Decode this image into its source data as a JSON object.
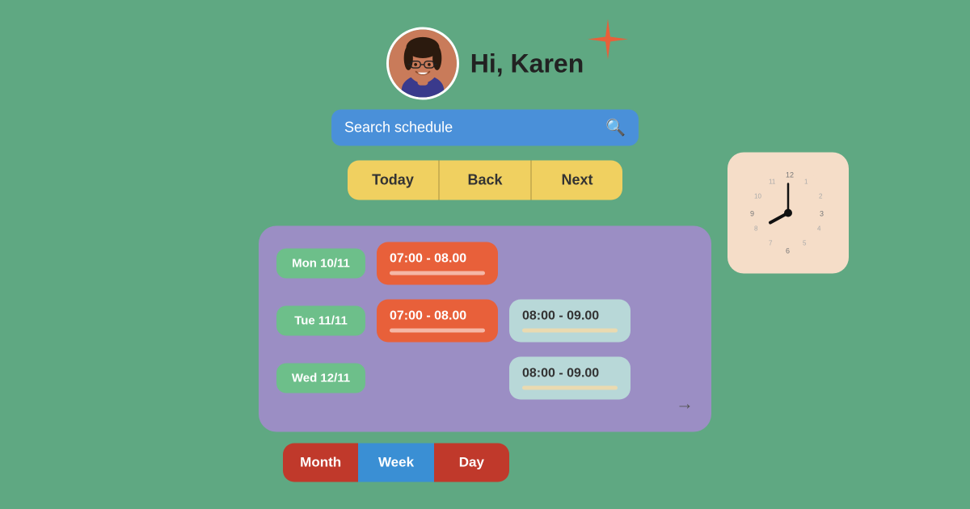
{
  "greeting": "Hi, Karen",
  "search": {
    "placeholder": "Search schedule"
  },
  "nav": {
    "today": "Today",
    "back": "Back",
    "next": "Next"
  },
  "clock": {
    "label": "clock-widget"
  },
  "schedule": {
    "rows": [
      {
        "day": "Mon 10/11",
        "blocks": [
          {
            "time": "07:00 - 08.00",
            "type": "orange"
          }
        ]
      },
      {
        "day": "Tue 11/11",
        "blocks": [
          {
            "time": "07:00 - 08.00",
            "type": "orange"
          },
          {
            "time": "08:00 - 09.00",
            "type": "teal"
          }
        ]
      },
      {
        "day": "Wed 12/11",
        "blocks": [
          {
            "time": "08:00 - 09.00",
            "type": "teal"
          }
        ]
      }
    ]
  },
  "tabs": {
    "month": "Month",
    "week": "Week",
    "day": "Day"
  },
  "arrow": "→"
}
